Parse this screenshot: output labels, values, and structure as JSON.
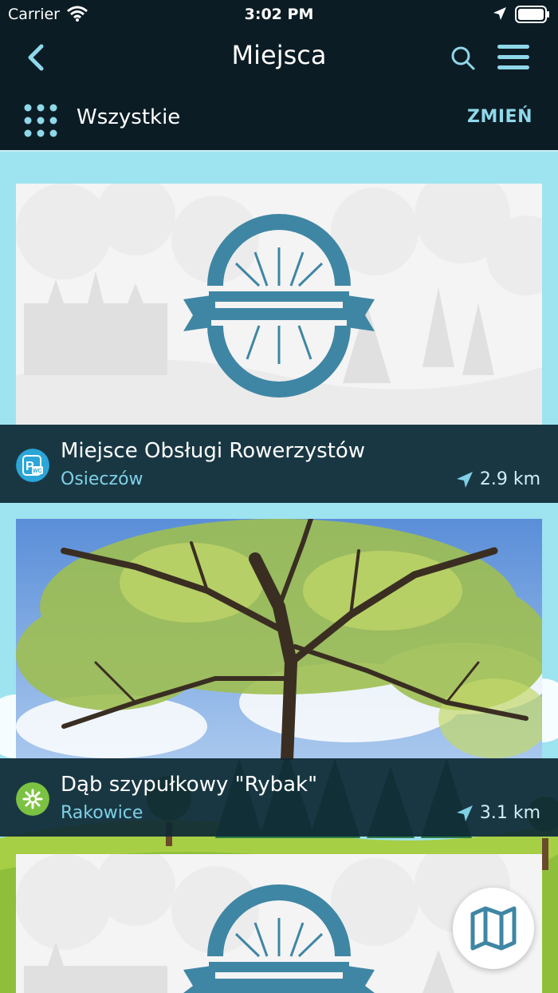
{
  "status": {
    "carrier": "Carrier",
    "time": "3:02 PM"
  },
  "header": {
    "title": "Miejsca"
  },
  "filter": {
    "label": "Wszystkie",
    "change": "ZMIEŃ"
  },
  "places": [
    {
      "name": "Miejsce Obsługi Rowerzystów",
      "town": "Osieczów",
      "distance": "2.9 km",
      "category_icon": "parking-wc-icon"
    },
    {
      "name": "Dąb szypułkowy \"Rybak\"",
      "town": "Rakowice",
      "distance": "3.1 km",
      "category_icon": "nature-icon"
    }
  ],
  "colors": {
    "dark": "#0c1c24",
    "accent": "#8fd8ea",
    "sky": "#9ee3f0",
    "logo": "#3f86a4"
  }
}
